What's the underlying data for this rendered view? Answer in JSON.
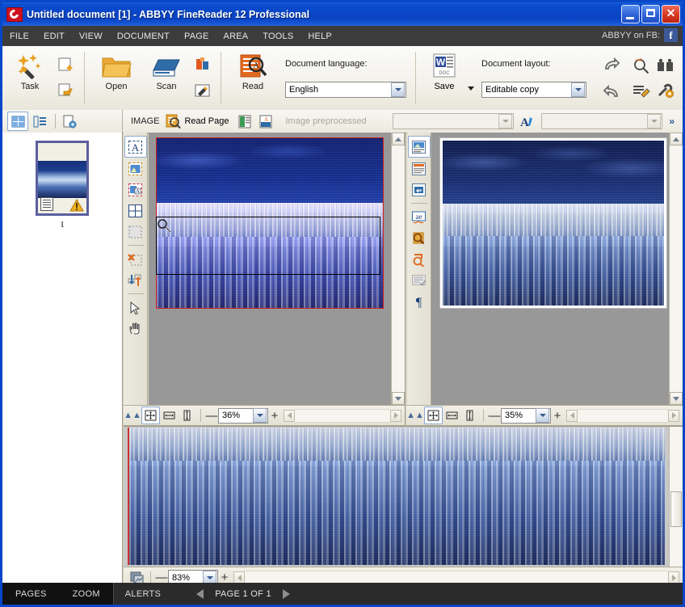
{
  "window": {
    "title": "Untitled document [1] - ABBYY FineReader 12 Professional",
    "logo_icon": "abbyy-logo-icon",
    "minimize_icon": "minimize-icon",
    "maximize_icon": "maximize-icon",
    "close_icon": "close-icon",
    "titlebar_color": "#0a46c8"
  },
  "menubar": {
    "items": [
      {
        "label": "FILE"
      },
      {
        "label": "EDIT"
      },
      {
        "label": "VIEW"
      },
      {
        "label": "DOCUMENT"
      },
      {
        "label": "PAGE"
      },
      {
        "label": "AREA"
      },
      {
        "label": "TOOLS"
      },
      {
        "label": "HELP"
      }
    ],
    "social_label": "ABBYY on FB:",
    "social_icon_text": "f",
    "social_icon_color": "#3b5998"
  },
  "toolbar": {
    "task_label": "Task",
    "open_label": "Open",
    "scan_label": "Scan",
    "read_label": "Read",
    "save_label": "Save",
    "new_document_icon": "new-document-icon",
    "open_document_icon": "open-document-icon",
    "scan_options_icon": "scan-options-icon",
    "edit_image_icon": "edit-image-icon",
    "language_caption": "Document language:",
    "language_value": "English",
    "layout_caption": "Document layout:",
    "layout_value": "Editable copy",
    "undo_icon": "undo-icon",
    "redo_icon": "redo-icon",
    "spellcheck_icon": "spellcheck-icon",
    "compare_icon": "compare-documents-icon",
    "verify_text_icon": "verify-text-icon",
    "options_icon": "options-wrench-icon"
  },
  "toolbar2": {
    "layout_view_icon": "layout-view-icon",
    "list_view_icon": "list-view-icon",
    "page_options_icon": "page-options-icon",
    "image_label": "IMAGE",
    "read_page_label": "Read Page",
    "read_page_icon": "read-page-icon",
    "split_page_icon": "split-page-icon",
    "preprocess_icon": "preprocess-image-icon",
    "preprocessed_status": "Image preprocessed",
    "font_name_value": "",
    "font_size_value": "",
    "font_icon": "font-format-icon",
    "overflow_label": "»"
  },
  "pages_panel": {
    "page_number": "1",
    "page_status_icon": "page-recognized-icon",
    "warning_icon": "warning-triangle-icon"
  },
  "image_tools": [
    {
      "name": "text-area-tool",
      "selected": true
    },
    {
      "name": "image-area-tool",
      "selected": false
    },
    {
      "name": "background-image-area-tool",
      "selected": false
    },
    {
      "name": "table-area-tool",
      "selected": false
    },
    {
      "name": "recognition-area-tool",
      "selected": false
    },
    {
      "name": "delete-area-tool",
      "selected": false
    },
    {
      "name": "reorder-areas-tool",
      "selected": false
    },
    {
      "name": "pointer-tool",
      "selected": false
    },
    {
      "name": "hand-tool",
      "selected": false
    }
  ],
  "text_tools": [
    {
      "name": "image-and-text-view-icon"
    },
    {
      "name": "text-view-icon"
    },
    {
      "name": "line-break-icon"
    },
    {
      "name": "spelling-icon"
    },
    {
      "name": "find-previous-icon"
    },
    {
      "name": "find-next-icon"
    },
    {
      "name": "verify-icon"
    },
    {
      "name": "paragraph-marks-icon"
    }
  ],
  "image_pane": {
    "zoom_value": "36%",
    "fit_page_icon": "fit-page-icon",
    "fit_width_icon": "fit-width-icon",
    "fit_height_icon": "fit-height-icon",
    "zoom_out_label": "—",
    "zoom_in_label": "+",
    "collapse_icon": "collapse-chevron-icon",
    "image_description": "snowy forest photo, color-inverted purple tint",
    "area_border_color": "#d22020"
  },
  "text_pane": {
    "zoom_value": "35%",
    "fit_page_icon": "fit-page-icon",
    "fit_width_icon": "fit-width-icon",
    "fit_height_icon": "fit-height-icon",
    "zoom_out_label": "—",
    "zoom_in_label": "+",
    "collapse_icon": "collapse-chevron-icon",
    "image_description": "snowy blue forest photo on white page"
  },
  "zoom_pane": {
    "zoom_value": "83%",
    "mode_icon": "zoom-mode-icon",
    "zoom_out_label": "—",
    "zoom_in_label": "+",
    "image_description": "snowy blue forest close-up"
  },
  "statusbar": {
    "tabs": [
      {
        "label": "PAGES",
        "active": true
      },
      {
        "label": "ZOOM",
        "active": true
      }
    ],
    "alerts_label": "ALERTS",
    "prev_icon": "previous-page-arrow",
    "next_icon": "next-page-arrow",
    "page_indicator": "PAGE 1 OF 1"
  }
}
